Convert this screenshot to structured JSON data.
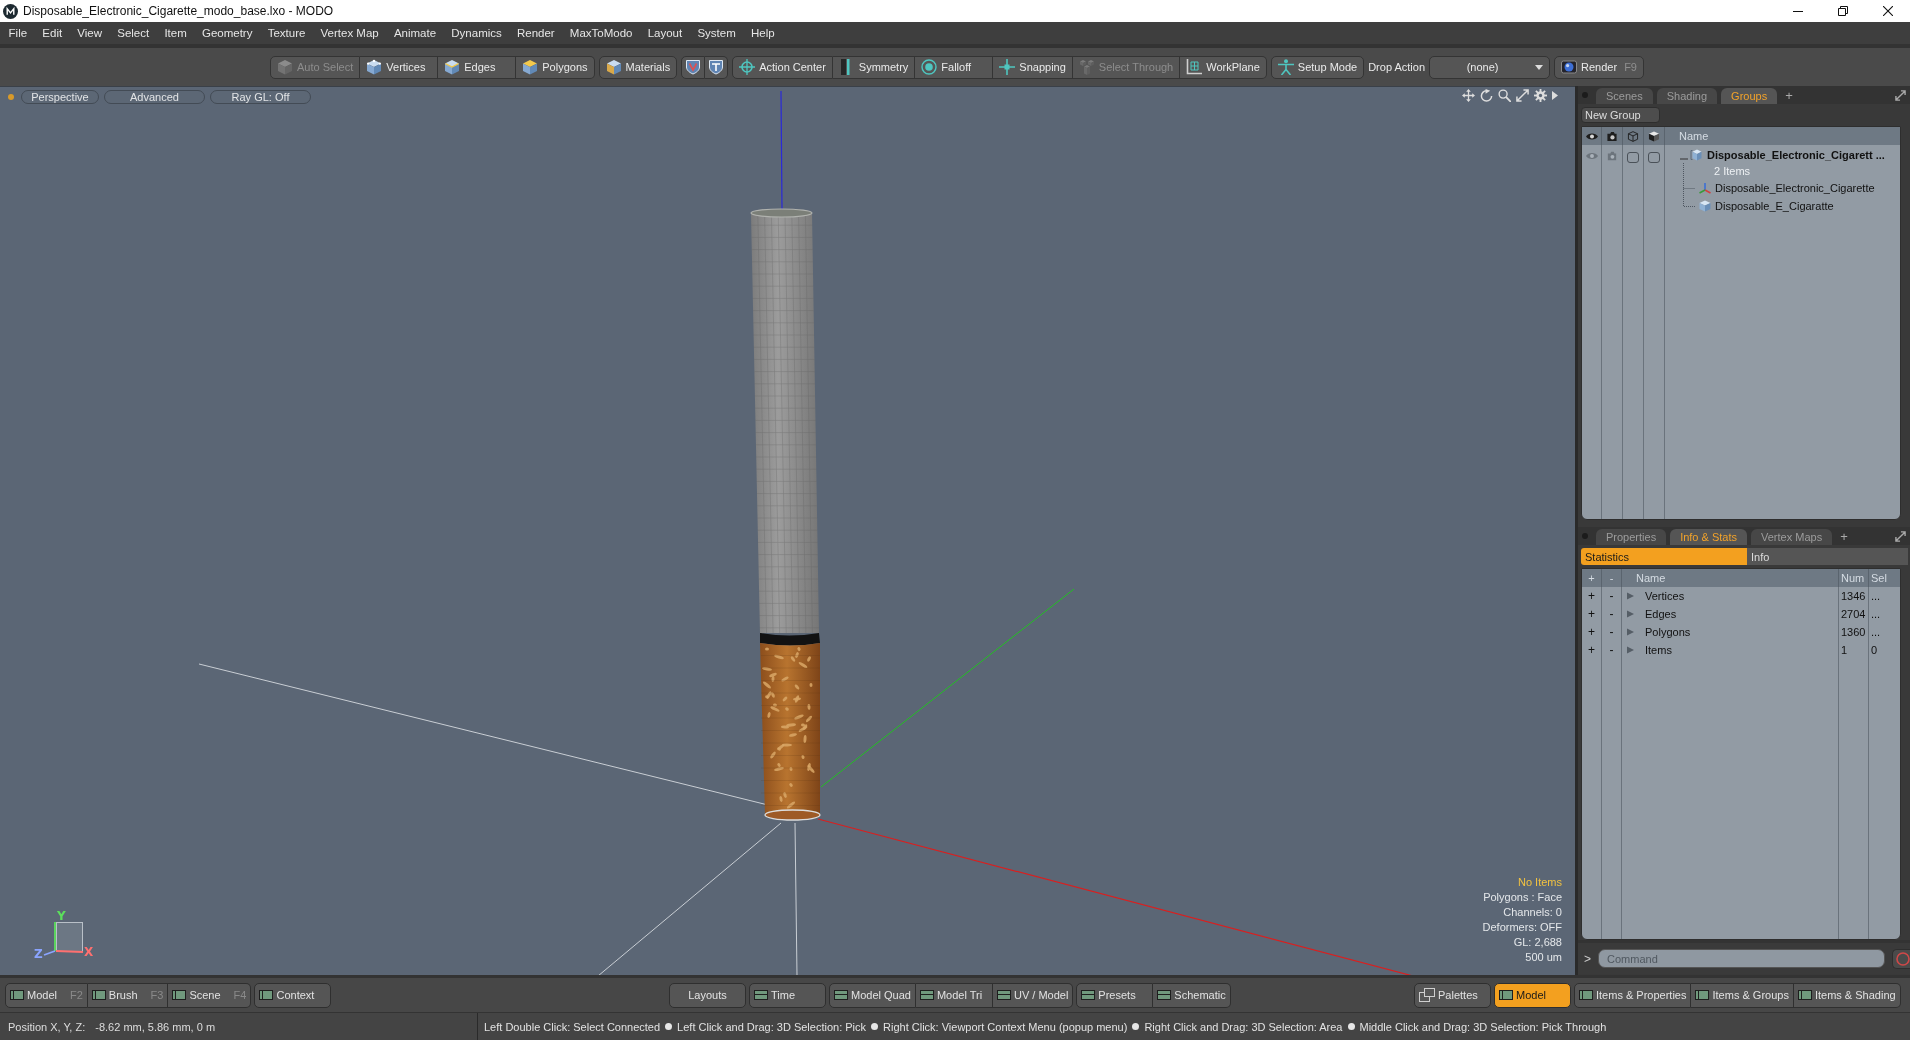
{
  "window": {
    "title": "Disposable_Electronic_Cigarette_modo_base.lxo - MODO"
  },
  "menu_bar": [
    "File",
    "Edit",
    "View",
    "Select",
    "Item",
    "Geometry",
    "Texture",
    "Vertex Map",
    "Animate",
    "Dynamics",
    "Render",
    "MaxToModo",
    "Layout",
    "System",
    "Help"
  ],
  "toolbar": {
    "groups": [
      {
        "kind": "buttons",
        "buttons": [
          {
            "label": "Auto Select",
            "disabled": true
          },
          {
            "label": "Vertices",
            "disabled": false
          },
          {
            "label": "Edges",
            "disabled": false
          },
          {
            "label": "Polygons",
            "disabled": false
          }
        ]
      },
      {
        "kind": "buttons",
        "buttons": [
          {
            "label": "Materials",
            "disabled": false
          }
        ]
      },
      {
        "kind": "buttons",
        "buttons": [
          {
            "disabled": false
          },
          {
            "disabled": false
          }
        ]
      },
      {
        "kind": "buttons",
        "buttons": [
          {
            "label": "Action Center",
            "disabled": false
          },
          {
            "label": "Symmetry",
            "disabled": false
          },
          {
            "label": "Falloff",
            "disabled": false
          },
          {
            "label": "Snapping",
            "disabled": false
          },
          {
            "label": "Select Through",
            "disabled": true
          },
          {
            "label": "WorkPlane",
            "disabled": false
          }
        ]
      },
      {
        "kind": "buttons",
        "buttons": [
          {
            "label": "Setup Mode",
            "disabled": false
          }
        ]
      },
      {
        "kind": "label",
        "text": "Drop Action"
      },
      {
        "kind": "dropdown",
        "value": "(none)"
      },
      {
        "kind": "buttons",
        "buttons": [
          {
            "label": "Render",
            "shortcut": "F9",
            "disabled": false
          }
        ]
      }
    ]
  },
  "viewport": {
    "buttons": [
      "Perspective",
      "Advanced",
      "Ray GL: Off"
    ],
    "axes": [
      {
        "label": "Y",
        "color": "#5ce05c"
      },
      {
        "label": "Z",
        "color": "#8aa4ff"
      },
      {
        "label": "X",
        "color": "#ff7070"
      }
    ],
    "info": [
      {
        "text": "No Items",
        "highlighted": true
      },
      {
        "text": "Polygons : Face",
        "highlighted": false
      },
      {
        "text": "Channels: 0",
        "highlighted": false
      },
      {
        "text": "Deformers: OFF",
        "highlighted": false
      },
      {
        "text": "GL: 2,688",
        "highlighted": false
      },
      {
        "text": "500 um",
        "highlighted": false
      }
    ]
  },
  "groups_panel": {
    "tabs": [
      {
        "label": "Scenes",
        "selected": false
      },
      {
        "label": "Shading",
        "selected": false
      },
      {
        "label": "Groups",
        "selected": true
      }
    ],
    "add_tab": "+",
    "new_group": "New Group",
    "name_column": "Name",
    "tree": [
      {
        "name": "Disposable_Electronic_Cigarett ...",
        "count": "2 Items",
        "kind": "group",
        "expanded": true,
        "children": [
          {
            "name": "Disposable_Electronic_Cigarette",
            "kind": "locator"
          },
          {
            "name": "Disposable_E_Cigaratte",
            "kind": "mesh"
          }
        ]
      }
    ]
  },
  "stats_panel": {
    "tabs": [
      {
        "label": "Properties",
        "selected": false
      },
      {
        "label": "Info & Stats",
        "selected": true
      },
      {
        "label": "Vertex Maps",
        "selected": false
      }
    ],
    "add_tab": "+",
    "subtabs": [
      {
        "label": "Statistics",
        "selected": true
      },
      {
        "label": "Info",
        "selected": false
      }
    ],
    "columns": [
      "+",
      "-",
      "Name",
      "Num",
      "Sel"
    ],
    "rows": [
      {
        "add": "+",
        "remove": "-",
        "name": "Vertices",
        "num": "1346",
        "sel": "...",
        "expanded": false
      },
      {
        "add": "+",
        "remove": "-",
        "name": "Edges",
        "num": "2704",
        "sel": "...",
        "expanded": false
      },
      {
        "add": "+",
        "remove": "-",
        "name": "Polygons",
        "num": "1360",
        "sel": "...",
        "expanded": false
      },
      {
        "add": "+",
        "remove": "-",
        "name": "Items",
        "num": "1",
        "sel": "0",
        "expanded": false
      }
    ]
  },
  "command": {
    "prompt": ">",
    "placeholder": "Command"
  },
  "layout_bar": {
    "sections": [
      {
        "groups": [
          {
            "buttons": [
              {
                "label": "Model",
                "shortcut": "F2",
                "selected": false
              },
              {
                "label": "Brush",
                "shortcut": "F3",
                "selected": false
              },
              {
                "label": "Scene",
                "shortcut": "F4",
                "selected": false
              }
            ]
          },
          {
            "buttons": [
              {
                "label": "Context",
                "selected": false
              }
            ]
          }
        ]
      },
      {
        "groups": [
          {
            "buttons": [
              {
                "label": "Layouts",
                "selected": false
              }
            ]
          },
          {
            "buttons": [
              {
                "label": "Time",
                "selected": false
              }
            ]
          },
          {
            "buttons": [
              {
                "label": "Model Quad",
                "selected": false
              },
              {
                "label": "Model Tri",
                "selected": false
              },
              {
                "label": "UV / Model",
                "selected": false
              }
            ]
          },
          {
            "buttons": [
              {
                "label": "Presets",
                "selected": false
              },
              {
                "label": "Schematic",
                "selected": false
              }
            ]
          }
        ]
      },
      {
        "groups": [
          {
            "buttons": [
              {
                "label": "Palettes",
                "selected": false
              }
            ]
          },
          {
            "buttons": [
              {
                "label": "Model",
                "selected": true
              }
            ]
          },
          {
            "buttons": [
              {
                "label": "Items & Properties",
                "selected": false
              },
              {
                "label": "Items & Groups",
                "selected": false
              },
              {
                "label": "Items & Shading",
                "selected": false
              }
            ]
          }
        ]
      }
    ]
  },
  "status_bar": {
    "position_label": "Position X, Y, Z:",
    "position_value": "-8.62 mm, 5.86 mm, 0 m",
    "hints": [
      "Left Double Click: Select Connected",
      "Left Click and Drag: 3D Selection: Pick",
      "Right Click: Viewport Context Menu (popup menu)",
      "Right Click and Drag: 3D Selection: Area",
      "Middle Click and Drag: 3D Selection: Pick Through"
    ]
  }
}
